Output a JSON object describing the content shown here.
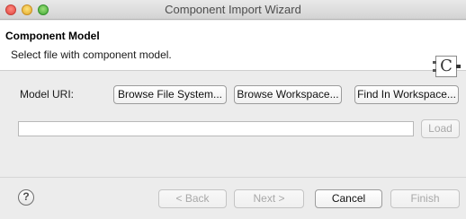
{
  "window": {
    "title": "Component Import Wizard"
  },
  "header": {
    "title": "Component Model",
    "description": "Select file with component model.",
    "icon_glyph": "C"
  },
  "form": {
    "model_uri_label": "Model URI:",
    "browse_file_system_label": "Browse File System...",
    "browse_workspace_label": "Browse Workspace...",
    "find_in_workspace_label": "Find In Workspace...",
    "uri_value": "",
    "load_label": "Load"
  },
  "footer": {
    "help_glyph": "?",
    "back_label": "< Back",
    "next_label": "Next >",
    "cancel_label": "Cancel",
    "finish_label": "Finish"
  },
  "icons": {
    "help": "help-icon",
    "component": "component-icon",
    "close": "close-icon",
    "minimize": "minimize-icon",
    "maximize": "maximize-icon"
  }
}
